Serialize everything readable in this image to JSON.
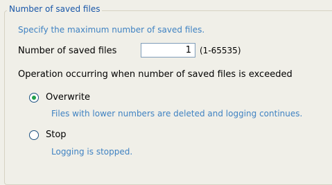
{
  "group": {
    "title": "Number of saved files"
  },
  "description": "Specify the maximum number of saved files.",
  "saved_files": {
    "label": "Number of saved files",
    "value": "1",
    "range": "(1-65535)"
  },
  "operation": {
    "heading": "Operation occurring when number of saved files is exceeded",
    "options": [
      {
        "label": "Overwrite",
        "description": "Files with lower numbers are deleted and logging continues.",
        "selected": true
      },
      {
        "label": "Stop",
        "description": "Logging is stopped.",
        "selected": false
      }
    ]
  },
  "colors": {
    "accent": "#3f82c2",
    "title": "#1856a8",
    "radio_dot": "#1fa04a",
    "background": "#f0efe8"
  }
}
